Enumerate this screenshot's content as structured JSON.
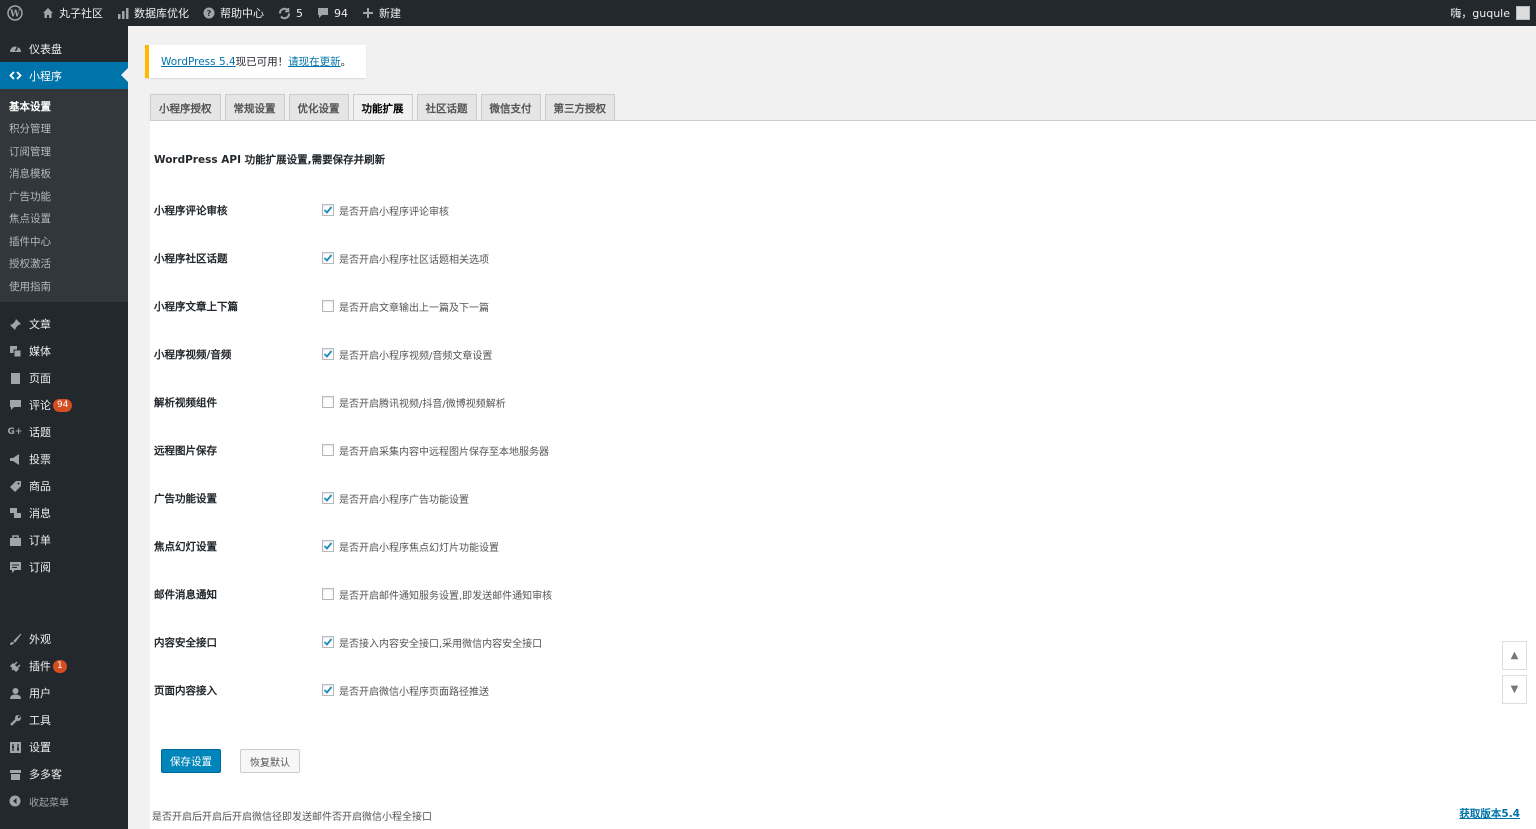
{
  "adminbar": {
    "site_name": "丸子社区",
    "db_optimize": "数据库优化",
    "help": "帮助中心",
    "updates": "5",
    "comments": "94",
    "new": "新建",
    "greeting": "嗨，guqule"
  },
  "sidebar": {
    "dashboard": "仪表盘",
    "miniprogram": "小程序",
    "submenu": [
      "基本设置",
      "积分管理",
      "订阅管理",
      "消息模板",
      "广告功能",
      "焦点设置",
      "插件中心",
      "授权激活",
      "使用指南"
    ],
    "posts": "文章",
    "media": "媒体",
    "pages": "页面",
    "comments": "评论",
    "comments_count": "94",
    "topics": "话题",
    "votes": "投票",
    "products": "商品",
    "messages": "消息",
    "orders": "订单",
    "subscribe": "订阅",
    "appearance": "外观",
    "plugins": "插件",
    "plugins_count": "1",
    "users": "用户",
    "tools": "工具",
    "settings": "设置",
    "duoduoke": "多多客",
    "collapse": "收起菜单"
  },
  "notice": {
    "link1": "WordPress 5.4",
    "text": "现已可用！",
    "link2": "请现在更新",
    "end": "。"
  },
  "tabs": [
    "小程序授权",
    "常规设置",
    "优化设置",
    "功能扩展",
    "社区话题",
    "微信支付",
    "第三方授权"
  ],
  "section_title": "WordPress API 功能扩展设置,需要保存并刷新",
  "settings": [
    {
      "label": "小程序评论审核",
      "desc": "是否开启小程序评论审核",
      "checked": true
    },
    {
      "label": "小程序社区话题",
      "desc": "是否开启小程序社区话题相关选项",
      "checked": true
    },
    {
      "label": "小程序文章上下篇",
      "desc": "是否开启文章输出上一篇及下一篇",
      "checked": false
    },
    {
      "label": "小程序视频/音频",
      "desc": "是否开启小程序视频/音频文章设置",
      "checked": true
    },
    {
      "label": "解析视频组件",
      "desc": "是否开启腾讯视频/抖音/微博视频解析",
      "checked": false
    },
    {
      "label": "远程图片保存",
      "desc": "是否开启采集内容中远程图片保存至本地服务器",
      "checked": false
    },
    {
      "label": "广告功能设置",
      "desc": "是否开启小程序广告功能设置",
      "checked": true
    },
    {
      "label": "焦点幻灯设置",
      "desc": "是否开启小程序焦点幻灯片功能设置",
      "checked": true
    },
    {
      "label": "邮件消息通知",
      "desc": "是否开启邮件通知服务设置,即发送邮件通知审核",
      "checked": false
    },
    {
      "label": "内容安全接口",
      "desc": "是否接入内容安全接口,采用微信内容安全接口",
      "checked": true
    },
    {
      "label": "页面内容接入",
      "desc": "是否开启微信小程序页面路径推送",
      "checked": true
    }
  ],
  "buttons": {
    "save": "保存设置",
    "reset": "恢复默认"
  },
  "footer": {
    "note": "是否开启后开启后开启微信径即发送邮件否开启微信小程全接口",
    "link": "获取版本5.4"
  },
  "colors": {
    "admin_bar": "#23282d",
    "accent": "#0073aa",
    "notice": "#ffb900",
    "badge": "#d54e21"
  }
}
